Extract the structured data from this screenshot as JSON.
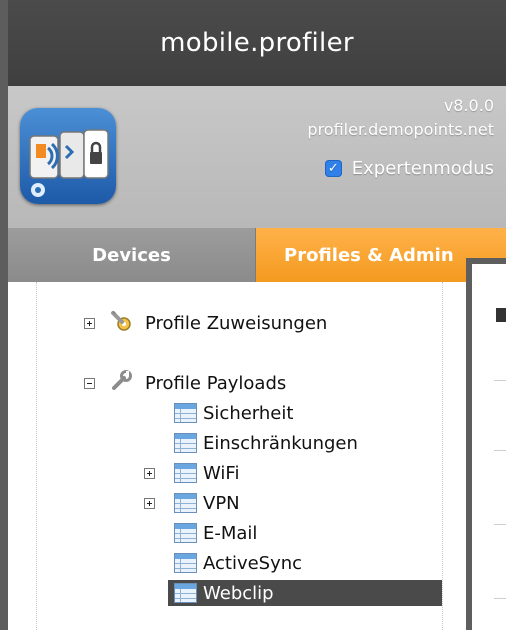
{
  "app": {
    "title": "mobile.profiler"
  },
  "info": {
    "version": "v8.0.0",
    "server": "profiler.demopoints.net",
    "expert_mode_label": "Expertenmodus",
    "expert_mode_checked": true
  },
  "tabs": [
    {
      "label": "Devices",
      "active": false
    },
    {
      "label": "Profiles & Admin",
      "active": true
    }
  ],
  "tree": {
    "assignments": {
      "label": "Profile Zuweisungen",
      "expander": "plus",
      "icon": "wrench-gear-icon"
    },
    "payloads": {
      "label": "Profile Payloads",
      "expander": "minus",
      "icon": "wrench-icon",
      "children": [
        {
          "label": "Sicherheit",
          "expander": "none"
        },
        {
          "label": "Einschränkungen",
          "expander": "none"
        },
        {
          "label": "WiFi",
          "expander": "plus"
        },
        {
          "label": "VPN",
          "expander": "plus"
        },
        {
          "label": "E-Mail",
          "expander": "none"
        },
        {
          "label": "ActiveSync",
          "expander": "none"
        },
        {
          "label": "Webclip",
          "expander": "none",
          "selected": true
        }
      ]
    }
  },
  "colors": {
    "titlebar": "#444444",
    "tab_active": "#f7a22e",
    "checkbox": "#2f80e8",
    "selection": "#4a4a4a"
  }
}
